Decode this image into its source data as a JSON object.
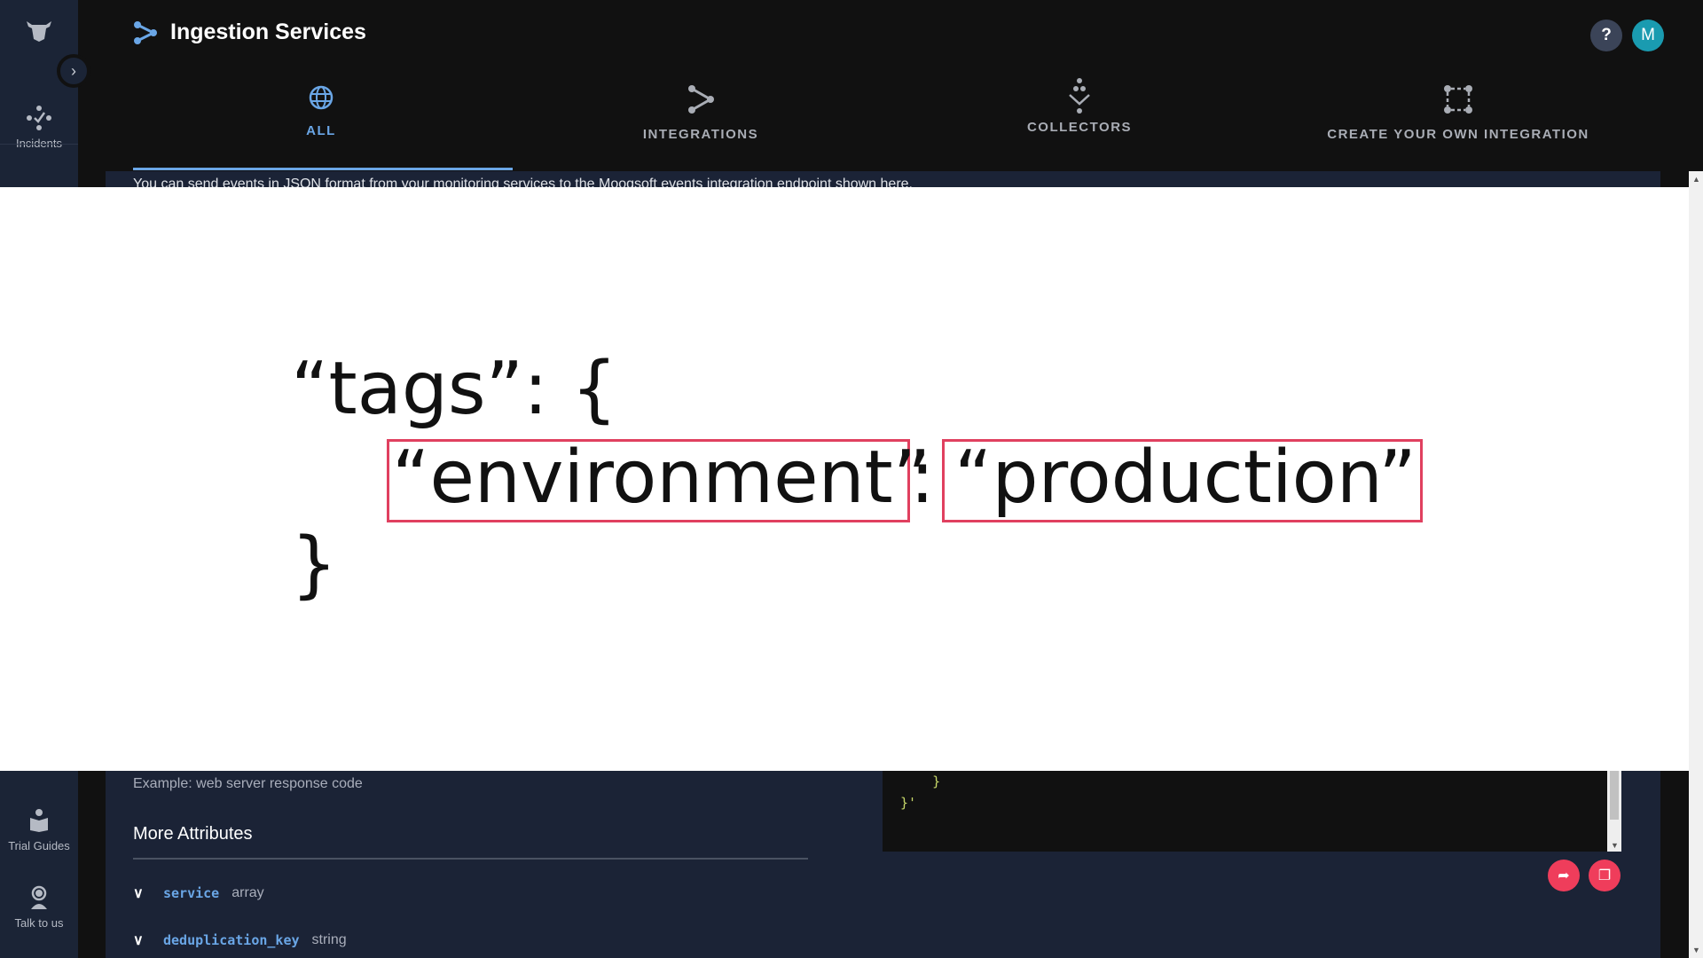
{
  "sidebar": {
    "top_items": [
      {
        "label": "Incidents",
        "icon": "incidents-icon"
      }
    ],
    "bottom_items": [
      {
        "label": "Trial Guides",
        "icon": "book-reader-icon"
      },
      {
        "label": "Talk to us",
        "icon": "support-agent-icon"
      }
    ]
  },
  "header": {
    "title": "Ingestion Services",
    "help_label": "?",
    "avatar_initial": "M",
    "avatar_color": "#1a9bb0"
  },
  "tabs": [
    {
      "label": "ALL",
      "icon": "globe-icon",
      "active": true
    },
    {
      "label": "INTEGRATIONS",
      "icon": "share-icon"
    },
    {
      "label": "COLLECTORS",
      "icon": "collector-icon"
    },
    {
      "label": "CREATE YOUR OWN INTEGRATION",
      "icon": "custom-integration-icon"
    }
  ],
  "banner": "You can send events in JSON format from your monitoring services to the Moogsoft events integration endpoint shown here.",
  "overlay": {
    "line1": "“tags”: {",
    "key": "“environment”",
    "colon": ":",
    "value": "“production”",
    "line3": "}",
    "highlight_color": "#e0405f"
  },
  "main": {
    "example": "Example: web server response code",
    "more_attributes": "More Attributes",
    "attributes": [
      {
        "key": "service",
        "type": "array"
      },
      {
        "key": "deduplication_key",
        "type": "string"
      }
    ]
  },
  "code": {
    "line1": "    }",
    "line2": "}'"
  },
  "accent": "#6aa6e6"
}
